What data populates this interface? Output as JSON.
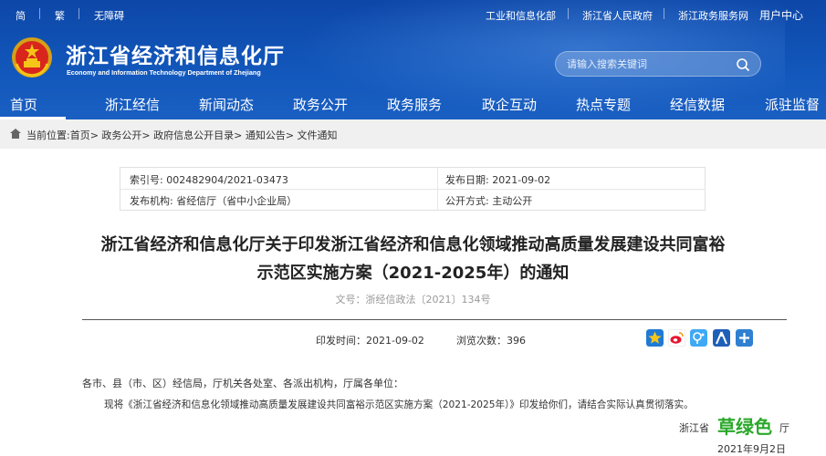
{
  "topbar": {
    "simplified": "简",
    "traditional": "繁",
    "accessibility": "无障碍",
    "links": [
      "工业和信息化部",
      "浙江省人民政府",
      "浙江政务服务网"
    ],
    "user_center": "用户中心"
  },
  "site": {
    "title": "浙江省经济和信息化厅",
    "subtitle": "Economy and Information Technology Department of Zhejiang"
  },
  "search": {
    "placeholder": "请输入搜索关键词"
  },
  "nav": {
    "items": [
      "首页",
      "浙江经信",
      "新闻动态",
      "政务公开",
      "政务服务",
      "政企互动",
      "热点专题",
      "经信数据",
      "派驻监督"
    ],
    "active": "首页"
  },
  "breadcrumb": "当前位置:首页> 政务公开> 政府信息公开目录> 通知公告> 文件通知",
  "meta": {
    "index_no": "索引号: 002482904/2021-03473",
    "publish_date": "发布日期: 2021-09-02",
    "issuer": "发布机构: 省经信厅（省中小企业局）",
    "disclosure": "公开方式: 主动公开"
  },
  "document": {
    "title_line1": "浙江省经济和信息化厅关于印发浙江省经济和信息化领域推动高质量发展建设共同富裕",
    "title_line2": "示范区实施方案（2021-2025年）的通知",
    "doc_number": "文号：浙经信政法〔2021〕134号",
    "print_time": "印发时间：2021-09-02",
    "views": "浏览次数：396",
    "salutation": "各市、县（市、区）经信局，厅机关各处室、各派出机构，厅属各单位：",
    "body_line1": "现将《浙江省经济和信息化领域推动高质量发展建设共同富裕示范区实施方案（2021-2025年）》印发给你们，请结合实际认真贯彻落实。",
    "signature": "浙江省",
    "signature_tail": "厅",
    "sign_date": "2021年9月2日"
  },
  "share_icons": [
    "qzone-star-icon",
    "weibo-icon",
    "tencent-weibo-icon",
    "renren-icon",
    "more-share-icon"
  ],
  "watermark": "草绿色",
  "colors": {
    "header_blue": "#1257bb",
    "crumb_bg": "#f0f0f0",
    "watermark_green": "#2aa82a"
  }
}
